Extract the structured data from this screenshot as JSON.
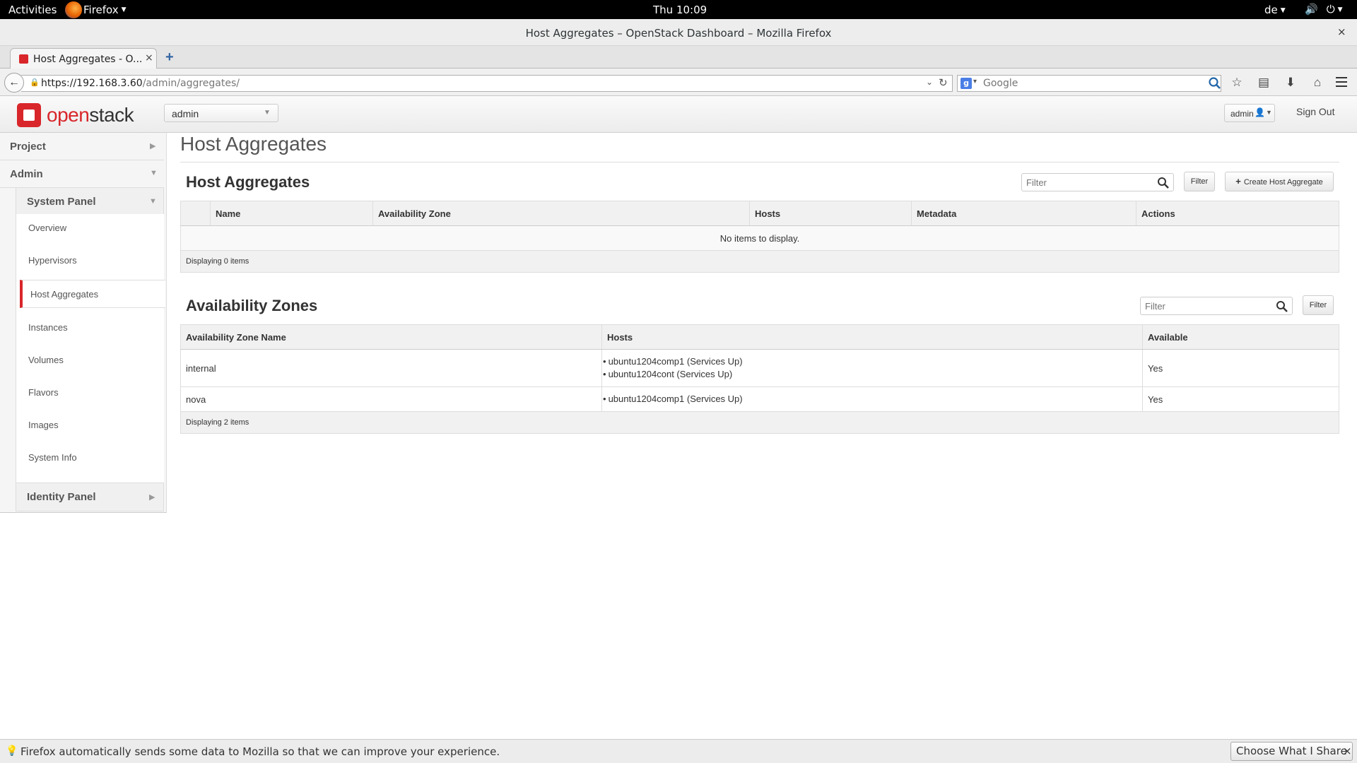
{
  "os": {
    "activities": "Activities",
    "app_name": "Firefox",
    "clock": "Thu 10:09",
    "lang": "de"
  },
  "window": {
    "title": "Host Aggregates – OpenStack Dashboard – Mozilla Firefox",
    "close": "×"
  },
  "browser": {
    "tab_title": "Host Aggregates - O...",
    "tab_close": "×",
    "new_tab": "+",
    "url_host": "https://192.168.3.60",
    "url_path": "/admin/aggregates/",
    "search_placeholder": "Google"
  },
  "header": {
    "logo_red": "open",
    "logo_dark": "stack",
    "project": "admin",
    "user": "admin",
    "sign_out": "Sign Out"
  },
  "sidebar": {
    "categories": [
      {
        "label": "Project"
      },
      {
        "label": "Admin"
      }
    ],
    "system_panel": "System Panel",
    "items": [
      {
        "label": "Overview"
      },
      {
        "label": "Hypervisors"
      },
      {
        "label": "Host Aggregates",
        "active": true
      },
      {
        "label": "Instances"
      },
      {
        "label": "Volumes"
      },
      {
        "label": "Flavors"
      },
      {
        "label": "Images"
      },
      {
        "label": "System Info"
      }
    ],
    "identity_panel": "Identity Panel"
  },
  "main": {
    "page_title": "Host Aggregates",
    "aggregates": {
      "title": "Host Aggregates",
      "filter_placeholder": "Filter",
      "filter_button": "Filter",
      "create_button": "Create Host Aggregate",
      "columns": [
        "Name",
        "Availability Zone",
        "Hosts",
        "Metadata",
        "Actions"
      ],
      "empty_message": "No items to display.",
      "footer": "Displaying 0 items"
    },
    "zones": {
      "title": "Availability Zones",
      "filter_placeholder": "Filter",
      "filter_button": "Filter",
      "columns": [
        "Availability Zone Name",
        "Hosts",
        "Available"
      ],
      "rows": [
        {
          "name": "internal",
          "hosts": [
            "ubuntu1204comp1 (Services Up)",
            "ubuntu1204cont (Services Up)"
          ],
          "available": "Yes"
        },
        {
          "name": "nova",
          "hosts": [
            "ubuntu1204comp1 (Services Up)"
          ],
          "available": "Yes"
        }
      ],
      "footer": "Displaying 2 items"
    }
  },
  "notification": {
    "message": "Firefox automatically sends some data to Mozilla so that we can improve your experience.",
    "button": "Choose What I Share",
    "close": "×"
  },
  "colors": {
    "accent": "#d8262a",
    "topbar": "#000000"
  }
}
